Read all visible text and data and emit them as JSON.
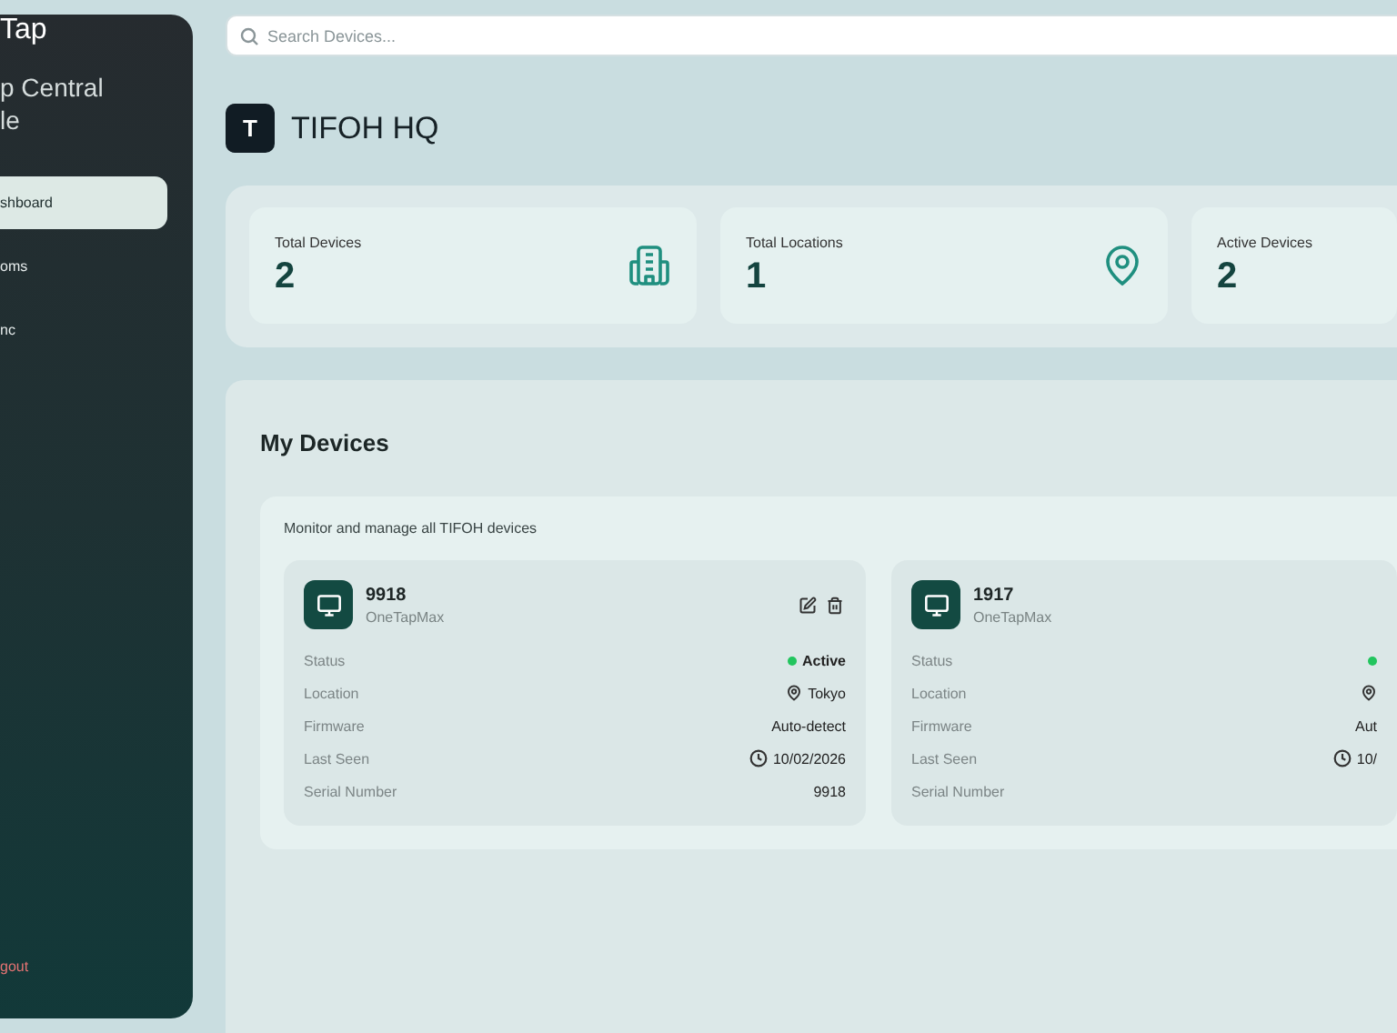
{
  "sidebar": {
    "brand": "Tap",
    "title_lines": [
      "p Central",
      "le"
    ],
    "items": [
      {
        "label": "shboard",
        "selected": true
      },
      {
        "label": "oms",
        "selected": false
      },
      {
        "label": "nc",
        "selected": false
      }
    ],
    "logout": "gout"
  },
  "search": {
    "placeholder": "Search Devices..."
  },
  "header": {
    "badge": "T",
    "title": "TIFOH HQ"
  },
  "stats": [
    {
      "label": "Total Devices",
      "value": "2",
      "kind": "building"
    },
    {
      "label": "Total Locations",
      "value": "1",
      "kind": "pin"
    },
    {
      "label": "Active Devices",
      "value": "2",
      "kind": "none"
    }
  ],
  "devices_section": {
    "title": "My Devices",
    "subtitle": "Monitor and manage all TIFOH devices",
    "devices": [
      {
        "name": "9918",
        "model": "OneTapMax",
        "actions": true,
        "rows": [
          {
            "label": "Status",
            "value": "Active",
            "kind": "status",
            "active": true
          },
          {
            "label": "Location",
            "value": "Tokyo",
            "kind": "location"
          },
          {
            "label": "Firmware",
            "value": "Auto-detect",
            "kind": "text"
          },
          {
            "label": "Last Seen",
            "value": "10/02/2026",
            "kind": "time"
          },
          {
            "label": "Serial Number",
            "value": "9918",
            "kind": "text"
          }
        ]
      },
      {
        "name": "1917",
        "model": "OneTapMax",
        "actions": false,
        "rows": [
          {
            "label": "Status",
            "kind": "status",
            "active": true
          },
          {
            "label": "Location",
            "kind": "location"
          },
          {
            "label": "Firmware",
            "value": "Aut",
            "kind": "text"
          },
          {
            "label": "Last Seen",
            "value": "10/",
            "kind": "time"
          },
          {
            "label": "Serial Number",
            "kind": "text"
          }
        ]
      }
    ]
  }
}
